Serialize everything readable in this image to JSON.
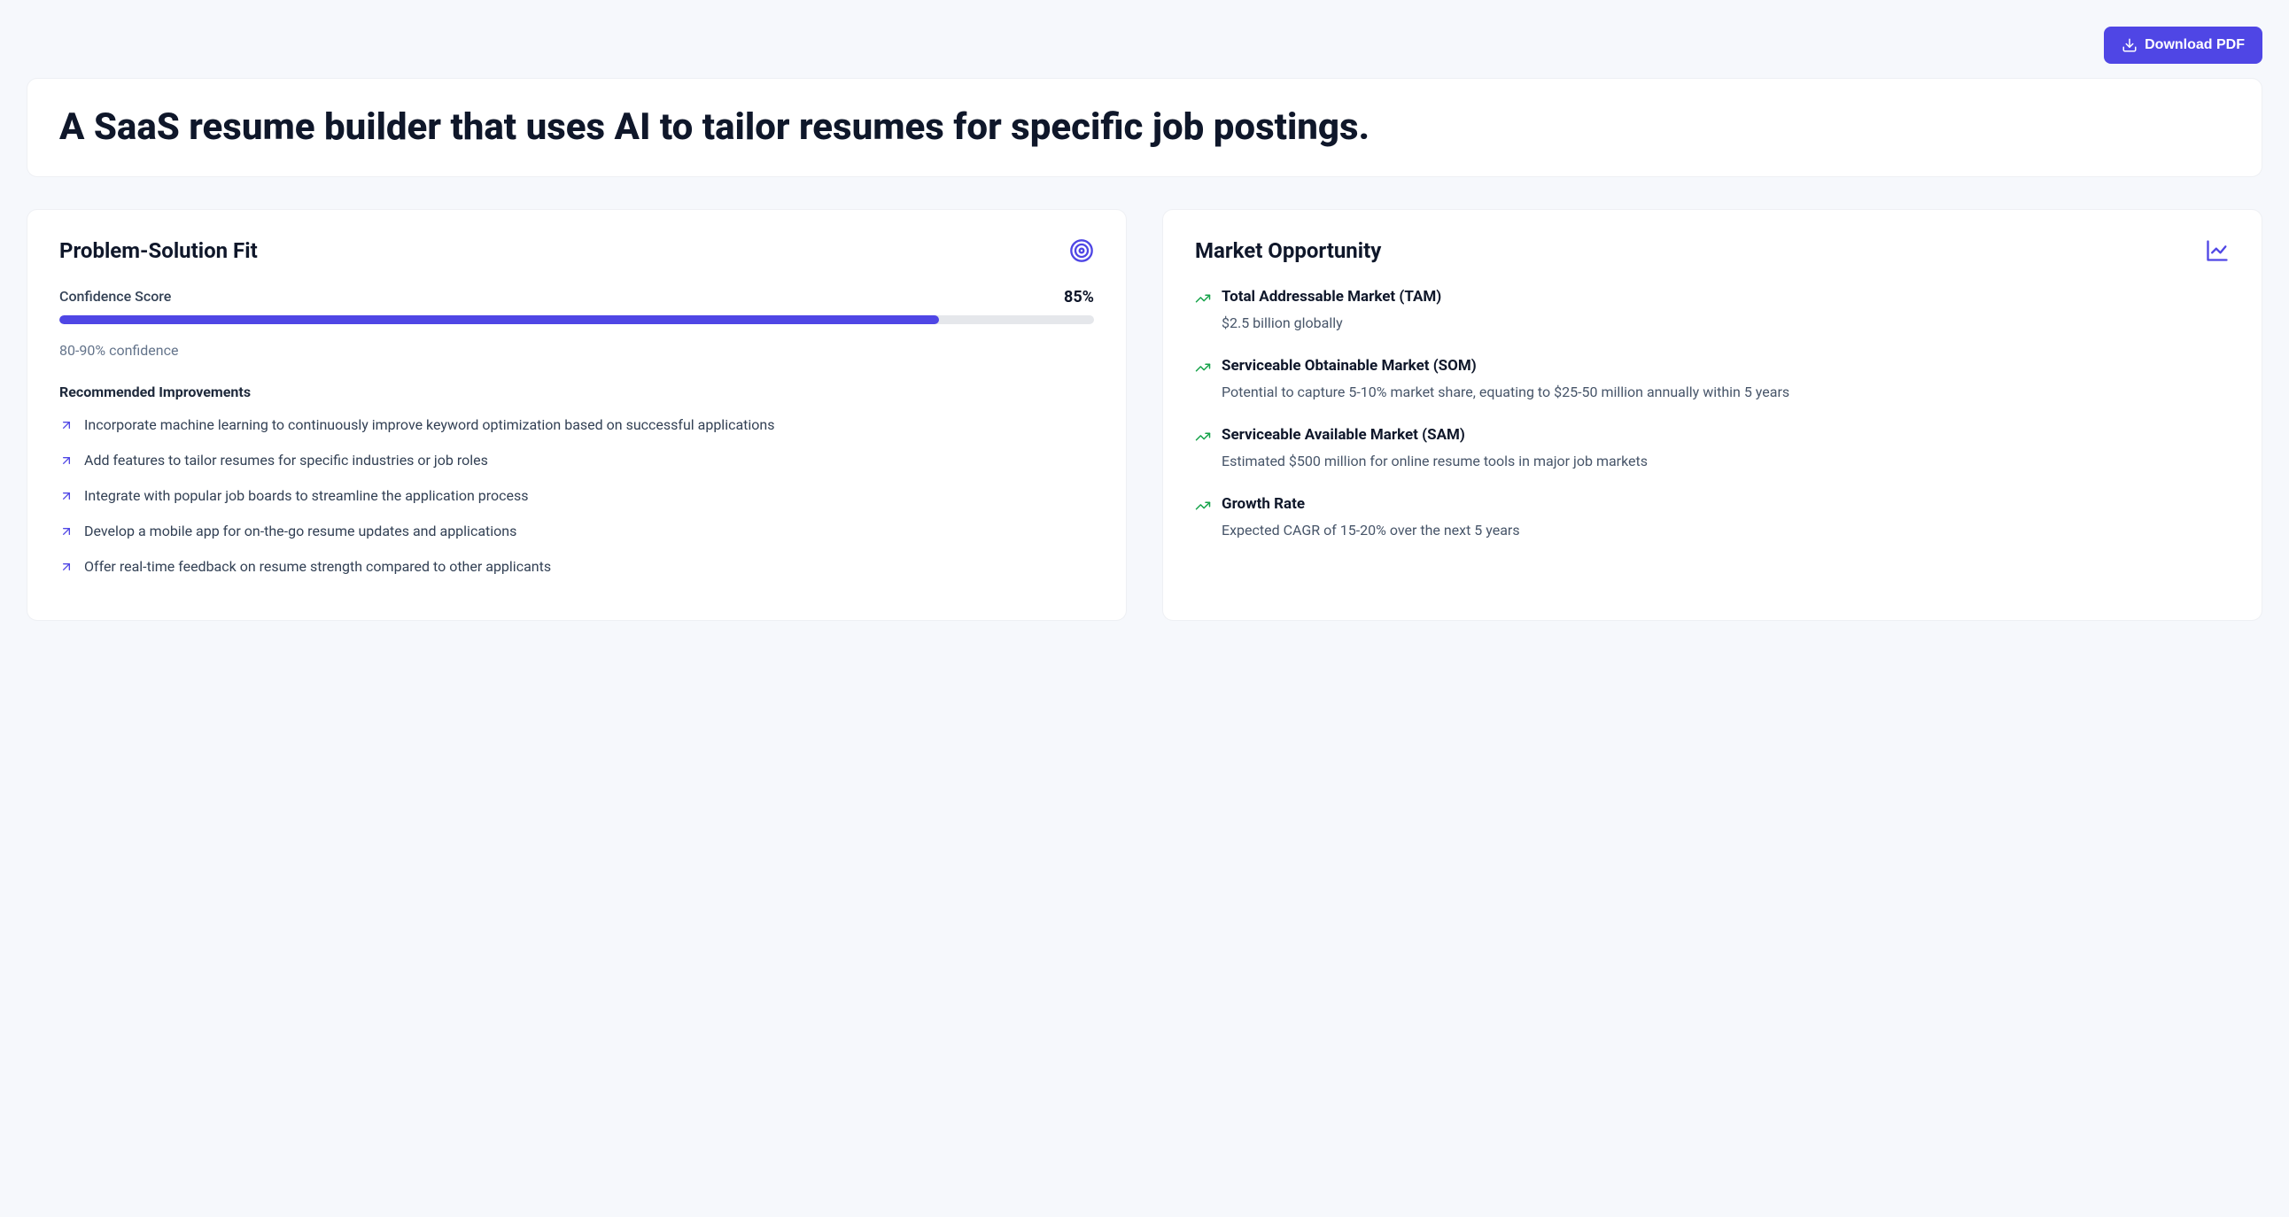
{
  "topbar": {
    "download_label": "Download PDF"
  },
  "title": "A SaaS resume builder that uses AI to tailor resumes for specific job postings.",
  "problem_solution": {
    "heading": "Problem-Solution Fit",
    "score_label": "Confidence Score",
    "score_value": "85%",
    "score_percent": 85,
    "confidence_note": "80-90% confidence",
    "recommended_heading": "Recommended Improvements",
    "recommendations": [
      "Incorporate machine learning to continuously improve keyword optimization based on successful applications",
      "Add features to tailor resumes for specific industries or job roles",
      "Integrate with popular job boards to streamline the application process",
      "Develop a mobile app for on-the-go resume updates and applications",
      "Offer real-time feedback on resume strength compared to other applicants"
    ]
  },
  "market": {
    "heading": "Market Opportunity",
    "items": [
      {
        "title": "Total Addressable Market (TAM)",
        "desc": "$2.5 billion globally"
      },
      {
        "title": "Serviceable Obtainable Market (SOM)",
        "desc": "Potential to capture 5-10% market share, equating to $25-50 million annually within 5 years"
      },
      {
        "title": "Serviceable Available Market (SAM)",
        "desc": "Estimated $500 million for online resume tools in major job markets"
      },
      {
        "title": "Growth Rate",
        "desc": "Expected CAGR of 15-20% over the next 5 years"
      }
    ]
  }
}
